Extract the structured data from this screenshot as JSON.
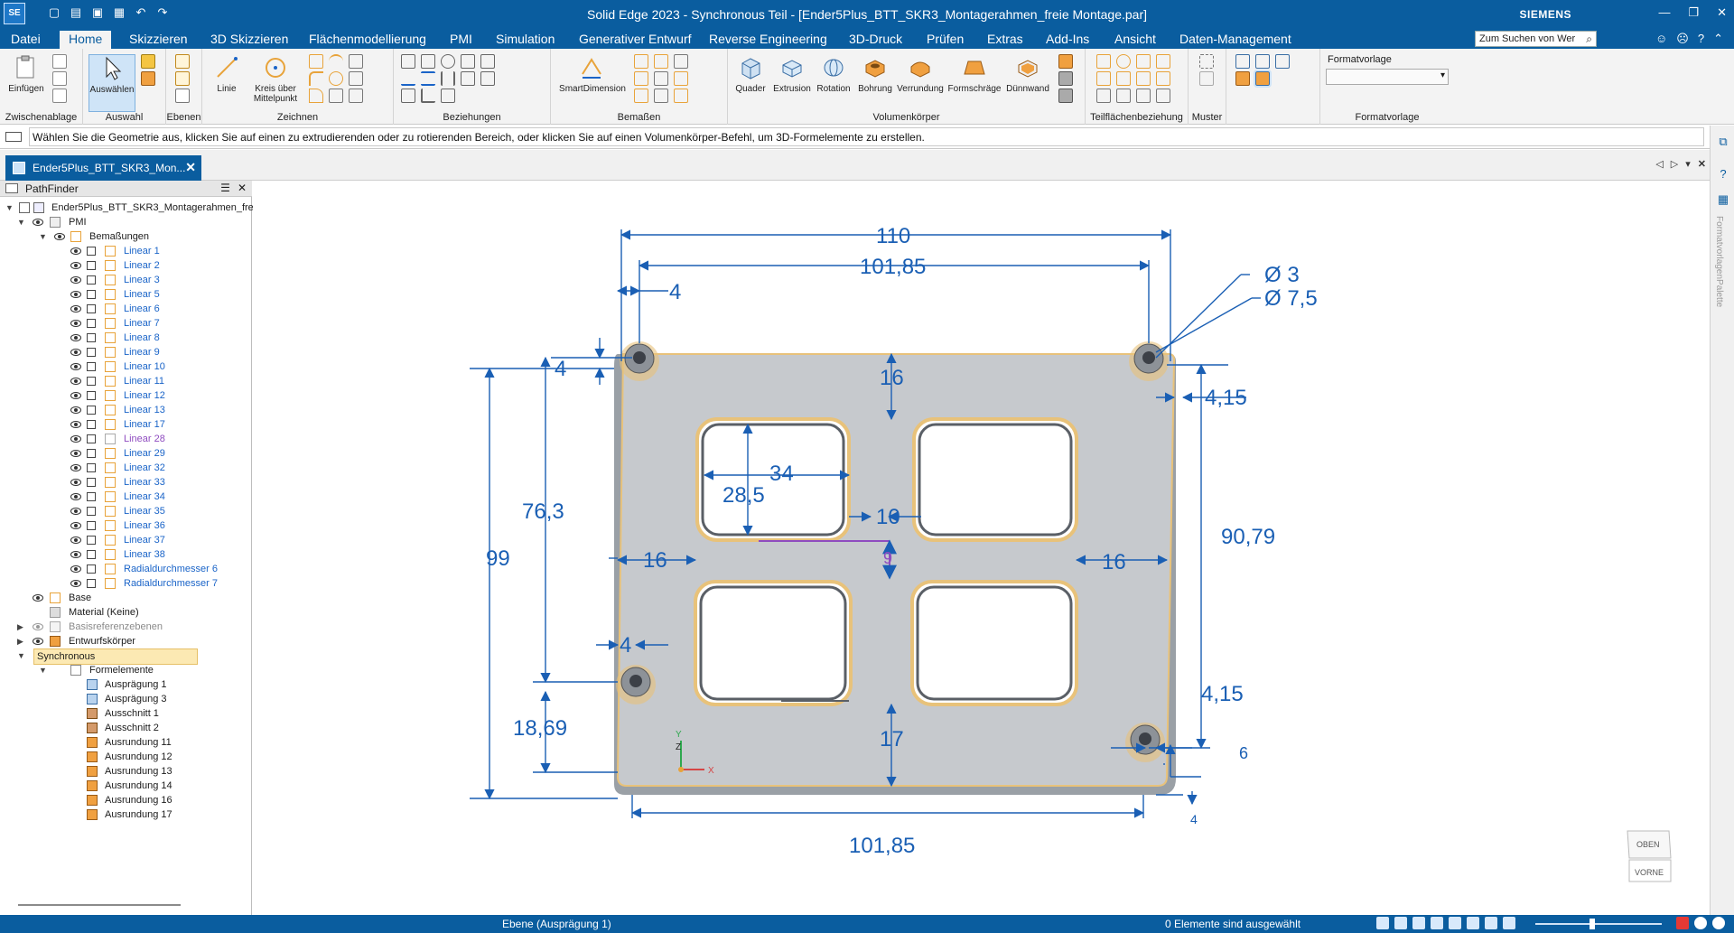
{
  "titlebar": {
    "app_logo": "SE",
    "title": "Solid Edge 2023 - Synchronous Teil - [Ender5Plus_BTT_SKR3_Montagerahmen_freie Montage.par]",
    "brand": "SIEMENS",
    "qat_icons": [
      "new-icon",
      "open-icon",
      "save-icon",
      "undo-icon",
      "redo-icon"
    ]
  },
  "menu": {
    "tabs": [
      "Datei",
      "Home",
      "Skizzieren",
      "3D Skizzieren",
      "Flächenmodellierung",
      "PMI",
      "Simulation",
      "Generativer Entwurf",
      "Reverse Engineering",
      "3D-Druck",
      "Prüfen",
      "Extras",
      "Add-Ins",
      "Ansicht",
      "Daten-Management"
    ],
    "active_tab": "Home",
    "search_placeholder": "Zum Suchen von Wer"
  },
  "ribbon": {
    "groups": {
      "clipboard": "Zwischenablage",
      "select": "Auswahl",
      "planes": "Ebenen",
      "draw": "Zeichnen",
      "relations": "Beziehungen",
      "dimension": "Bemaßen",
      "solids": "Volumenkörper",
      "face_relations": "Teilflächenbeziehung",
      "pattern": "Muster",
      "style": "Formatvorlage"
    },
    "buttons": {
      "paste": "Einfügen",
      "select": "Auswählen",
      "line": "Linie",
      "circle_l1": "Kreis über",
      "circle_l2": "Mittelpunkt",
      "smartdim": "SmartDimension",
      "box": "Quader",
      "extrude": "Extrusion",
      "revolve": "Rotation",
      "hole": "Bohrung",
      "round": "Verrundung",
      "draft": "Formschräge",
      "thinwall": "Dünnwand",
      "style_label": "Formatvorlage"
    }
  },
  "prompt": "Wählen Sie die Geometrie aus, klicken Sie auf einen zu extrudierenden oder zu rotierenden Bereich, oder klicken Sie auf einen Volumenkörper-Befehl, um 3D-Formelemente zu erstellen.",
  "doc_tab": "Ender5Plus_BTT_SKR3_Mon...",
  "pathfinder": {
    "title": "PathFinder",
    "root": "Ender5Plus_BTT_SKR3_Montagerahmen_fre",
    "pmi": "PMI",
    "dims_folder": "Bemaßungen",
    "dims": [
      "Linear 1",
      "Linear 2",
      "Linear 3",
      "Linear 5",
      "Linear 6",
      "Linear 7",
      "Linear 8",
      "Linear 9",
      "Linear 10",
      "Linear 11",
      "Linear 12",
      "Linear 13",
      "Linear 17",
      "Linear 28",
      "Linear 29",
      "Linear 32",
      "Linear 33",
      "Linear 34",
      "Linear 35",
      "Linear 36",
      "Linear 37",
      "Linear 38",
      "Radialdurchmesser 6",
      "Radialdurchmesser 7"
    ],
    "base": "Base",
    "material": "Material (Keine)",
    "refplanes": "Basisreferenzebenen",
    "design_body": "Entwurfskörper",
    "synchronous": "Synchronous",
    "features_folder": "Formelemente",
    "features": [
      "Ausprägung 1",
      "Ausprägung 3",
      "Ausschnitt 1",
      "Ausschnitt 2",
      "Ausrundung 11",
      "Ausrundung 12",
      "Ausrundung 13",
      "Ausrundung 14",
      "Ausrundung 16",
      "Ausrundung 17"
    ]
  },
  "dimensions": {
    "overall_width": "110",
    "hole_spacing_top": "101,85",
    "hole_spacing_bottom": "101,85",
    "dia_small": "Ø 3",
    "dia_large": "Ø 7,5",
    "offset_top_left": "4",
    "offset_left_top": "4",
    "offset_left_bottom": "4",
    "right_edge_top": "4,15",
    "right_edge_bottom": "4,15",
    "bridge_top": "16",
    "slot_width": "34",
    "slot_height": "28,5",
    "gap_center": "10",
    "gap_mid": "9",
    "left_margin": "16",
    "right_margin": "16",
    "height_763": "76,3",
    "overall_height": "99",
    "height_9079": "90,79",
    "bottom_1869": "18,69",
    "bridge_bottom": "17",
    "bottom_6": "6",
    "bottom_4": "4"
  },
  "triad": {
    "y": "Y",
    "z": "Z",
    "x": "X"
  },
  "viewcube": {
    "top": "OBEN",
    "front": "VORNE"
  },
  "status": {
    "left": "Ebene (Ausprägung 1)",
    "right": "0 Elemente sind ausgewählt"
  },
  "colors": {
    "brand_blue": "#0a5d9f",
    "dimension_blue": "#1a5fb4",
    "part_grey": "#c5c8cc",
    "highlight_edge": "#e8c27a"
  }
}
